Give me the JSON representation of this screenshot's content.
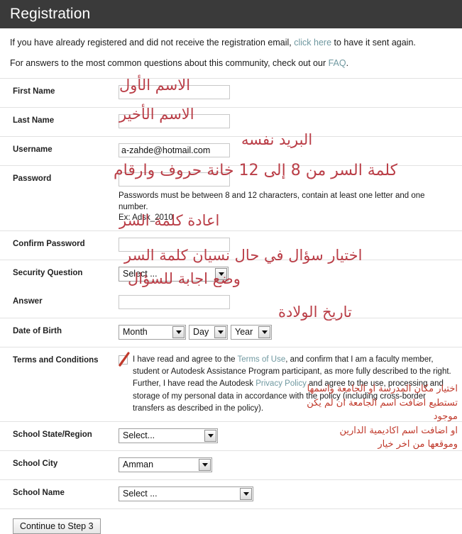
{
  "header": {
    "title": "Registration"
  },
  "intro": {
    "line1_pre": "If you have already registered and did not receive the registration email,",
    "line1_link": "click here",
    "line1_post": "to have it sent again.",
    "line2_pre": "For answers to the most common questions about this community, check out our",
    "line2_link": "FAQ",
    "line2_post": "."
  },
  "fields": {
    "first_name": {
      "label": "First Name",
      "value": "",
      "placeholder": ""
    },
    "last_name": {
      "label": "Last Name",
      "value": "",
      "placeholder": ""
    },
    "username": {
      "label": "Username",
      "value": "a-zahde@hotmail.com",
      "placeholder": ""
    },
    "password": {
      "label": "Password",
      "value": "",
      "placeholder": ""
    },
    "password_hint_line1": "Passwords must be between 8 and 12 characters, contain at least one letter and one number.",
    "password_hint_line2": "Ex: Adsk_2010",
    "confirm_password": {
      "label": "Confirm Password",
      "value": "",
      "placeholder": ""
    },
    "security_question": {
      "label": "Security Question",
      "selected": "Select ..."
    },
    "answer": {
      "label": "Answer",
      "value": "",
      "placeholder": ""
    },
    "date_of_birth": {
      "label": "Date of Birth",
      "month": "Month",
      "day": "Day",
      "year": "Year"
    },
    "terms": {
      "label": "Terms and Conditions",
      "checked": true,
      "text_part1": "I have read and agree to the ",
      "link1": "Terms of Use",
      "text_part2": ", and confirm that I am a faculty member, student or Autodesk Assistance Program participant, as more fully described to the right. Further, I have read the Autodesk ",
      "link2": "Privacy Policy",
      "text_part3": " and agree to the use, processing and storage of my personal data in accordance with the policy (including cross-border transfers as described in the policy)."
    },
    "school_state": {
      "label": "School State/Region",
      "selected": "Select..."
    },
    "school_city": {
      "label": "School City",
      "selected": "Amman"
    },
    "school_name": {
      "label": "School Name",
      "selected": "Select ..."
    }
  },
  "submit": {
    "label": "Continue to Step 3"
  },
  "annotations": {
    "first_name": "الاسم الأول",
    "last_name": "الاسم الأخير",
    "username": "البريد نفسه",
    "password": "كلمة السر من 8 إلى 12 خانة حروف وارقام",
    "confirm_password": "اعادة كلمة السر",
    "security_question": "اختيار سؤال في حال نسيان كلمة السر",
    "answer": "وضع اجابة للسؤال",
    "date_of_birth": "تاريخ الولادة",
    "school_block_line1": "اختيار مكان المدرسة او الجامعة واسمها",
    "school_block_line2": "تستطيع اضافت اسم الجامعة ان لم يكن",
    "school_block_line3": "موجود",
    "school_block_line4": "او اضافت اسم اكاديمية الدارين",
    "school_block_line5": "وموقعها من اخر خيار"
  },
  "colors": {
    "header_bg": "#3a3a3a",
    "link": "#6f98a0",
    "annotation_red": "#c0392b"
  }
}
